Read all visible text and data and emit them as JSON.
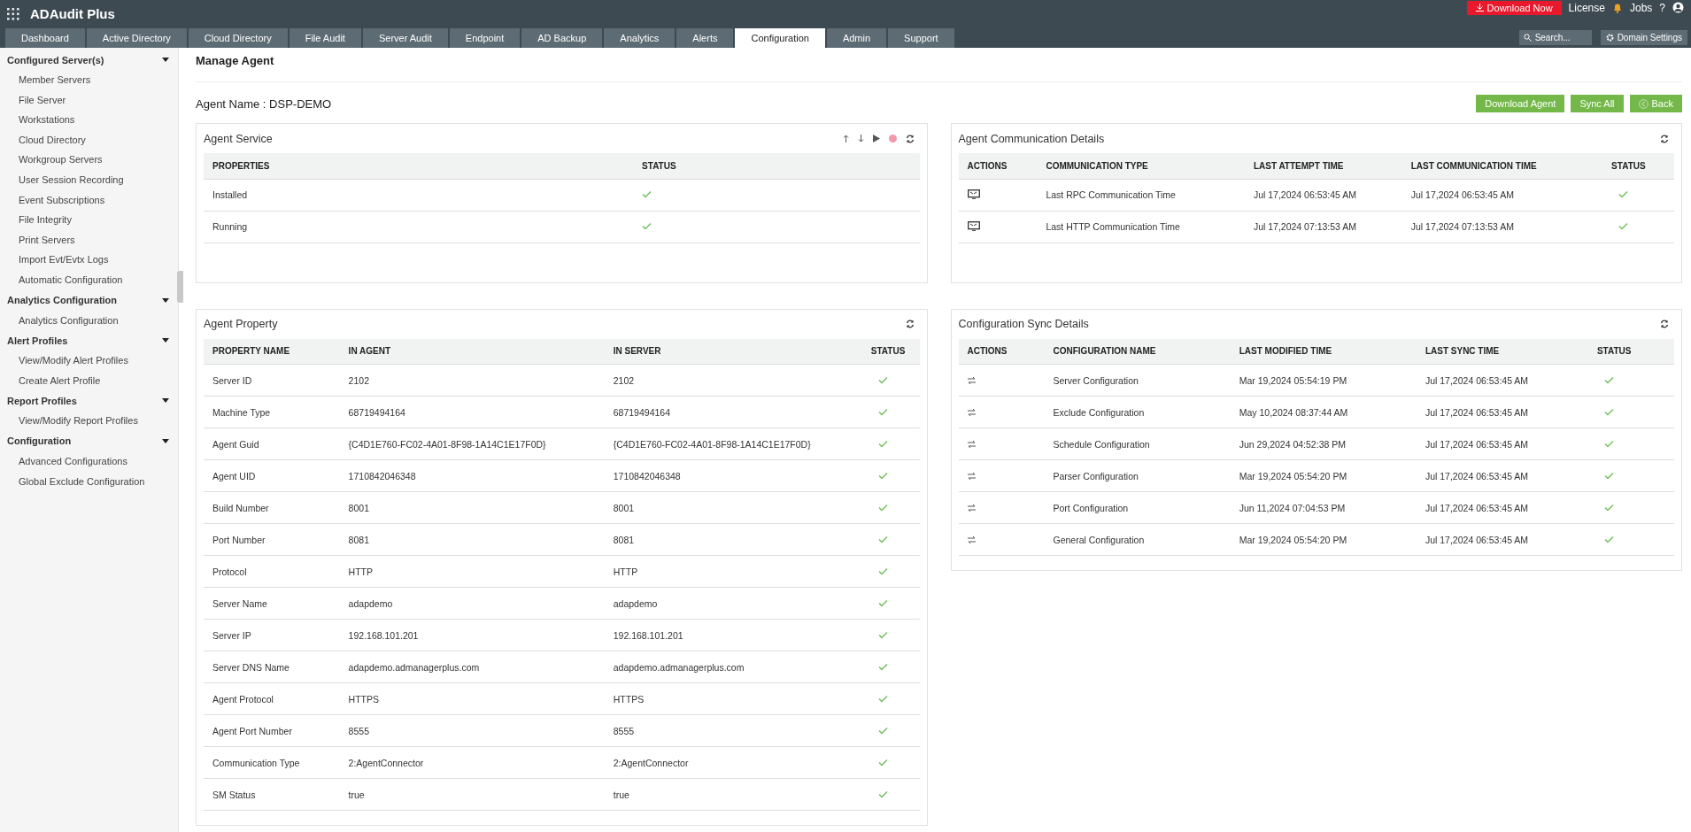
{
  "app": {
    "name": "ADAudit Plus"
  },
  "header": {
    "download": "Download Now",
    "license": "License",
    "jobs": "Jobs",
    "help": "?"
  },
  "tabs": [
    {
      "label": "Dashboard",
      "selected": false
    },
    {
      "label": "Active Directory",
      "selected": false
    },
    {
      "label": "Cloud Directory",
      "selected": false
    },
    {
      "label": "File Audit",
      "selected": false
    },
    {
      "label": "Server Audit",
      "selected": false
    },
    {
      "label": "Endpoint",
      "selected": false
    },
    {
      "label": "AD Backup",
      "selected": false
    },
    {
      "label": "Analytics",
      "selected": false
    },
    {
      "label": "Alerts",
      "selected": false
    },
    {
      "label": "Configuration",
      "selected": true
    },
    {
      "label": "Admin",
      "selected": false
    },
    {
      "label": "Support",
      "selected": false
    }
  ],
  "search": {
    "placeholder": "Search..."
  },
  "domain_settings": "Domain Settings",
  "sidebar": [
    {
      "title": "Configured Server(s)",
      "expanded": true,
      "items": [
        "Member Servers",
        "File Server",
        "Workstations",
        "Cloud Directory",
        "Workgroup Servers",
        "User Session Recording",
        "Event Subscriptions",
        "File Integrity",
        "Print Servers",
        "Import Evt/Evtx Logs",
        "Automatic Configuration"
      ]
    },
    {
      "title": "Analytics Configuration",
      "expanded": true,
      "items": [
        "Analytics Configuration"
      ]
    },
    {
      "title": "Alert Profiles",
      "expanded": true,
      "items": [
        "View/Modify Alert Profiles",
        "Create Alert Profile"
      ]
    },
    {
      "title": "Report Profiles",
      "expanded": true,
      "items": [
        "View/Modify Report Profiles"
      ]
    },
    {
      "title": "Configuration",
      "expanded": true,
      "items": [
        "Advanced Configurations",
        "Global Exclude Configuration"
      ]
    }
  ],
  "page_title": "Manage Agent",
  "agent_name": "Agent Name : DSP-DEMO",
  "buttons": [
    {
      "label": "Download Agent",
      "kind": "text"
    },
    {
      "label": "Sync All",
      "kind": "text"
    },
    {
      "label": "Back",
      "kind": "back"
    }
  ],
  "agent_service": {
    "title": "Agent Service",
    "columns": [
      "PROPERTIES",
      "STATUS"
    ],
    "rows": [
      {
        "property": "Installed",
        "ok": true
      },
      {
        "property": "Running",
        "ok": true
      }
    ]
  },
  "agent_property": {
    "title": "Agent Property",
    "columns": [
      "PROPERTY NAME",
      "IN AGENT",
      "IN SERVER",
      "STATUS"
    ],
    "rows": [
      {
        "name": "Server ID",
        "agent": "2102",
        "server": "2102",
        "ok": true
      },
      {
        "name": "Machine Type",
        "agent": "68719494164",
        "server": "68719494164",
        "ok": true
      },
      {
        "name": "Agent Guid",
        "agent": "{C4D1E760-FC02-4A01-8F98-1A14C1E17F0D}",
        "server": "{C4D1E760-FC02-4A01-8F98-1A14C1E17F0D}",
        "ok": true
      },
      {
        "name": "Agent UID",
        "agent": "1710842046348",
        "server": "1710842046348",
        "ok": true
      },
      {
        "name": "Build Number",
        "agent": "8001",
        "server": "8001",
        "ok": true
      },
      {
        "name": "Port Number",
        "agent": "8081",
        "server": "8081",
        "ok": true
      },
      {
        "name": "Protocol",
        "agent": "HTTP",
        "server": "HTTP",
        "ok": true
      },
      {
        "name": "Server Name",
        "agent": "adapdemo",
        "server": "adapdemo",
        "ok": true
      },
      {
        "name": "Server IP",
        "agent": "192.168.101.201",
        "server": "192.168.101.201",
        "ok": true
      },
      {
        "name": "Server DNS Name",
        "agent": "adapdemo.admanagerplus.com",
        "server": "adapdemo.admanagerplus.com",
        "ok": true
      },
      {
        "name": "Agent Protocol",
        "agent": "HTTPS",
        "server": "HTTPS",
        "ok": true
      },
      {
        "name": "Agent Port Number",
        "agent": "8555",
        "server": "8555",
        "ok": true
      },
      {
        "name": "Communication Type",
        "agent": "2:AgentConnector",
        "server": "2:AgentConnector",
        "ok": true
      },
      {
        "name": "SM Status",
        "agent": "true",
        "server": "true",
        "ok": true
      }
    ]
  },
  "communication": {
    "title": "Agent Communication Details",
    "columns": [
      "ACTIONS",
      "COMMUNICATION TYPE",
      "LAST ATTEMPT TIME",
      "LAST COMMUNICATION TIME",
      "STATUS"
    ],
    "rows": [
      {
        "type": "Last RPC Communication Time",
        "attempt": "Jul 17,2024 06:53:45 AM",
        "last": "Jul 17,2024 06:53:45 AM",
        "ok": true
      },
      {
        "type": "Last HTTP Communication Time",
        "attempt": "Jul 17,2024 07:13:53 AM",
        "last": "Jul 17,2024 07:13:53 AM",
        "ok": true
      }
    ]
  },
  "config_sync": {
    "title": "Configuration Sync Details",
    "columns": [
      "ACTIONS",
      "CONFIGURATION NAME",
      "LAST MODIFIED TIME",
      "LAST SYNC TIME",
      "STATUS"
    ],
    "rows": [
      {
        "name": "Server Configuration",
        "modified": "Mar 19,2024 05:54:19 PM",
        "sync": "Jul 17,2024 06:53:45 AM",
        "ok": true
      },
      {
        "name": "Exclude Configuration",
        "modified": "May 10,2024 08:37:44 AM",
        "sync": "Jul 17,2024 06:53:45 AM",
        "ok": true
      },
      {
        "name": "Schedule Configuration",
        "modified": "Jun 29,2024 04:52:38 PM",
        "sync": "Jul 17,2024 06:53:45 AM",
        "ok": true
      },
      {
        "name": "Parser Configuration",
        "modified": "Mar 19,2024 05:54:20 PM",
        "sync": "Jul 17,2024 06:53:45 AM",
        "ok": true
      },
      {
        "name": "Port Configuration",
        "modified": "Jun 11,2024 07:04:53 PM",
        "sync": "Jul 17,2024 06:53:45 AM",
        "ok": true
      },
      {
        "name": "General Configuration",
        "modified": "Mar 19,2024 05:54:20 PM",
        "sync": "Jul 17,2024 06:53:45 AM",
        "ok": true
      }
    ]
  }
}
